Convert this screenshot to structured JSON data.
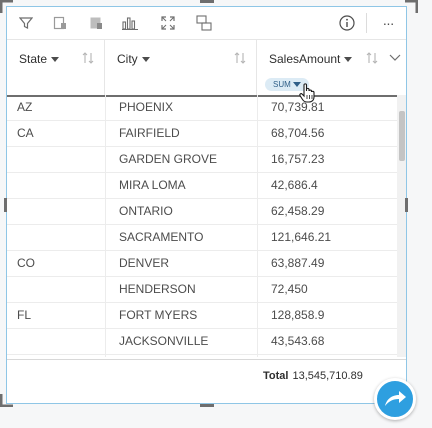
{
  "toolbar": {
    "icons": [
      "filter-icon",
      "visualization-type-icon",
      "card-style-icon",
      "bar-chart-icon",
      "maximize-icon",
      "flip-card-icon",
      "info-icon",
      "more-options-icon"
    ],
    "more_label": "···"
  },
  "columns": [
    {
      "label": "State"
    },
    {
      "label": "City"
    },
    {
      "label": "SalesAmount",
      "aggregation": "SUM"
    }
  ],
  "rows": [
    {
      "state": "AZ",
      "city": "PHOENIX",
      "sales": "70,739.81"
    },
    {
      "state": "CA",
      "city": "FAIRFIELD",
      "sales": "68,704.56"
    },
    {
      "state": "",
      "city": "GARDEN GROVE",
      "sales": "16,757.23"
    },
    {
      "state": "",
      "city": "MIRA LOMA",
      "sales": "42,686.4"
    },
    {
      "state": "",
      "city": "ONTARIO",
      "sales": "62,458.29"
    },
    {
      "state": "",
      "city": "SACRAMENTO",
      "sales": "121,646.21"
    },
    {
      "state": "CO",
      "city": "DENVER",
      "sales": "63,887.49"
    },
    {
      "state": "",
      "city": "HENDERSON",
      "sales": "72,450"
    },
    {
      "state": "FL",
      "city": "FORT MYERS",
      "sales": "128,858.9"
    },
    {
      "state": "",
      "city": "JACKSONVILLE",
      "sales": "43,543.68"
    }
  ],
  "footer": {
    "total_label": "Total",
    "total_value": "13,545,710.89"
  },
  "colors": {
    "accent": "#2e9fe0",
    "border": "#8fc6e6"
  }
}
